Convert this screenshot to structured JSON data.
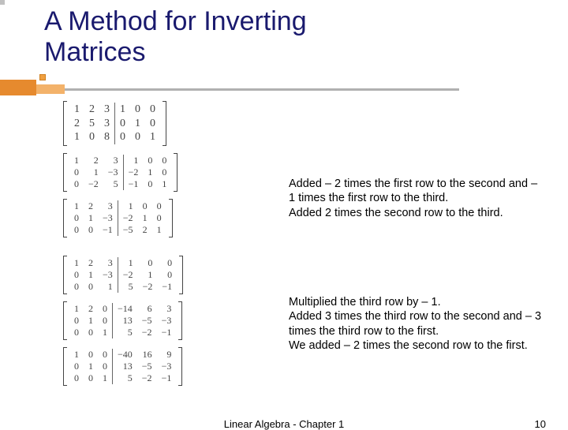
{
  "title_line1": "A Method for Inverting",
  "title_line2": "Matrices",
  "matrices": {
    "m0": [
      [
        "1",
        "2",
        "3",
        "1",
        "0",
        "0"
      ],
      [
        "2",
        "5",
        "3",
        "0",
        "1",
        "0"
      ],
      [
        "1",
        "0",
        "8",
        "0",
        "0",
        "1"
      ]
    ],
    "m1": [
      [
        "1",
        "2",
        "3",
        "1",
        "0",
        "0"
      ],
      [
        "0",
        "1",
        "−3",
        "−2",
        "1",
        "0"
      ],
      [
        "0",
        "−2",
        "5",
        "−1",
        "0",
        "1"
      ]
    ],
    "m2": [
      [
        "1",
        "2",
        "3",
        "1",
        "0",
        "0"
      ],
      [
        "0",
        "1",
        "−3",
        "−2",
        "1",
        "0"
      ],
      [
        "0",
        "0",
        "−1",
        "−5",
        "2",
        "1"
      ]
    ],
    "m3": [
      [
        "1",
        "2",
        "3",
        "1",
        "0",
        "0"
      ],
      [
        "0",
        "1",
        "−3",
        "−2",
        "1",
        "0"
      ],
      [
        "0",
        "0",
        "1",
        "5",
        "−2",
        "−1"
      ]
    ],
    "m4": [
      [
        "1",
        "2",
        "0",
        "−14",
        "6",
        "3"
      ],
      [
        "0",
        "1",
        "0",
        "13",
        "−5",
        "−3"
      ],
      [
        "0",
        "0",
        "1",
        "5",
        "−2",
        "−1"
      ]
    ],
    "m5": [
      [
        "1",
        "0",
        "0",
        "−40",
        "16",
        "9"
      ],
      [
        "0",
        "1",
        "0",
        "13",
        "−5",
        "−3"
      ],
      [
        "0",
        "0",
        "1",
        "5",
        "−2",
        "−1"
      ]
    ]
  },
  "notes": {
    "n1a": "Added – 2 times the first row to the second and – 1 times the first row to the third.",
    "n1b": "Added 2 times the second row to the third.",
    "n2a": "Multiplied the third row by – 1.",
    "n2b": "Added 3 times the third row to the second and – 3 times the third row to the first.",
    "n2c": "We added – 2 times the second row to the first."
  },
  "footer_text": "Linear Algebra - Chapter 1",
  "page_number": "10"
}
